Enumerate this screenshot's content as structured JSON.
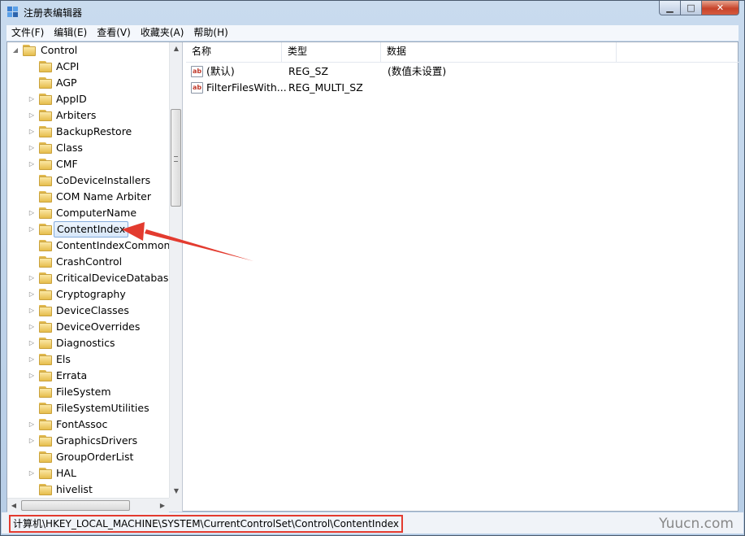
{
  "window": {
    "title": "注册表编辑器"
  },
  "menu": [
    "文件(F)",
    "编辑(E)",
    "查看(V)",
    "收藏夹(A)",
    "帮助(H)"
  ],
  "tree": {
    "root": "Control",
    "items": [
      {
        "label": "ACPI",
        "expandable": false
      },
      {
        "label": "AGP",
        "expandable": false
      },
      {
        "label": "AppID",
        "expandable": true
      },
      {
        "label": "Arbiters",
        "expandable": true
      },
      {
        "label": "BackupRestore",
        "expandable": true
      },
      {
        "label": "Class",
        "expandable": true
      },
      {
        "label": "CMF",
        "expandable": true
      },
      {
        "label": "CoDeviceInstallers",
        "expandable": false
      },
      {
        "label": "COM Name Arbiter",
        "expandable": false
      },
      {
        "label": "ComputerName",
        "expandable": true
      },
      {
        "label": "ContentIndex",
        "expandable": true,
        "selected": true
      },
      {
        "label": "ContentIndexCommon",
        "expandable": false
      },
      {
        "label": "CrashControl",
        "expandable": false
      },
      {
        "label": "CriticalDeviceDatabase",
        "expandable": true
      },
      {
        "label": "Cryptography",
        "expandable": true
      },
      {
        "label": "DeviceClasses",
        "expandable": true
      },
      {
        "label": "DeviceOverrides",
        "expandable": true
      },
      {
        "label": "Diagnostics",
        "expandable": true
      },
      {
        "label": "Els",
        "expandable": true
      },
      {
        "label": "Errata",
        "expandable": true
      },
      {
        "label": "FileSystem",
        "expandable": false
      },
      {
        "label": "FileSystemUtilities",
        "expandable": false
      },
      {
        "label": "FontAssoc",
        "expandable": true
      },
      {
        "label": "GraphicsDrivers",
        "expandable": true
      },
      {
        "label": "GroupOrderList",
        "expandable": false
      },
      {
        "label": "HAL",
        "expandable": true
      },
      {
        "label": "hivelist",
        "expandable": false
      }
    ]
  },
  "list": {
    "columns": [
      "名称",
      "类型",
      "数据"
    ],
    "rows": [
      {
        "icon": "ab",
        "name": "(默认)",
        "type": "REG_SZ",
        "data": "(数值未设置)"
      },
      {
        "icon": "ab",
        "name": "FilterFilesWith...",
        "type": "REG_MULTI_SZ",
        "data": ""
      }
    ]
  },
  "status": {
    "path": "计算机\\HKEY_LOCAL_MACHINE\\SYSTEM\\CurrentControlSet\\Control\\ContentIndex"
  },
  "watermark": "Yuucn.com",
  "colors": {
    "annotation": "#e33b2f",
    "selection": "#d7e7fa"
  }
}
